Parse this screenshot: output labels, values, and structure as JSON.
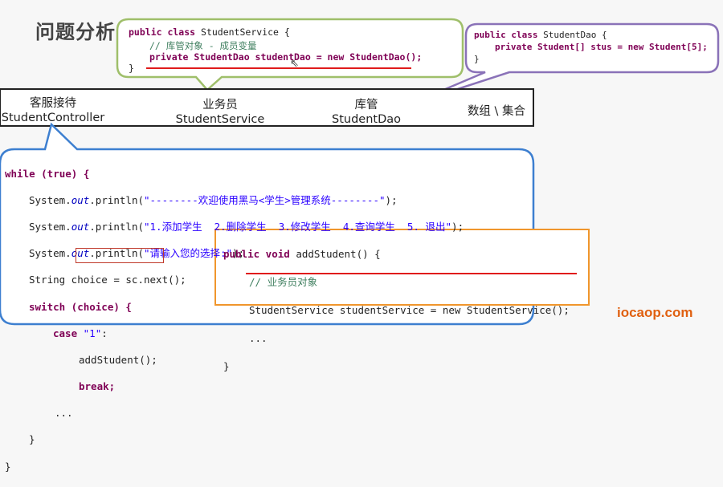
{
  "title": "问题分析",
  "service_bubble": {
    "line1": "public class StudentService {",
    "comment": "// 库管对象 - 成员变量",
    "line3": "private StudentDao studentDao = new StudentDao();",
    "close": "}"
  },
  "dao_bubble": {
    "line1": "public class StudentDao {",
    "line2": "private Student[] stus = new Student[5];",
    "close": "}"
  },
  "layers": {
    "controller": {
      "cn": "客服接待",
      "en": "StudentController"
    },
    "service": {
      "cn": "业务员",
      "en": "StudentService"
    },
    "dao": {
      "cn": "库管",
      "en": "StudentDao"
    },
    "data": "数组 \\ 集合"
  },
  "controller_code": {
    "l1": "while (true) {",
    "l2_pre": "System.",
    "l2_out": "out",
    "l2_mid": ".println(",
    "l2_str": "\"--------欢迎使用黑马<学生>管理系统--------\"",
    "l2_end": ");",
    "l3_str": "\"1.添加学生  2.删除学生  3.修改学生  4.查询学生  5. 退出\"",
    "l4_str": "\"请输入您的选择:\"",
    "l5": "String choice = sc.next();",
    "l6": "switch (choice) {",
    "l7_case": "case",
    "l7_str": "\"1\"",
    "l7_colon": ":",
    "l8": "addStudent();",
    "l9": "break;",
    "l10": "...",
    "l11": "}",
    "l12": "}"
  },
  "add_student_box": {
    "l1_sig": "addStudent() {",
    "comment": "// 业务员对象",
    "l3": "StudentService studentService = new StudentService();",
    "l4": "...",
    "close": "}"
  },
  "watermark": "iocaop.com",
  "colors": {
    "green_border": "#9fbf6a",
    "purple_border": "#8a72b8",
    "blue_border": "#3d7fd0",
    "orange_border": "#f0962c",
    "red_underline": "#e01b1b"
  }
}
